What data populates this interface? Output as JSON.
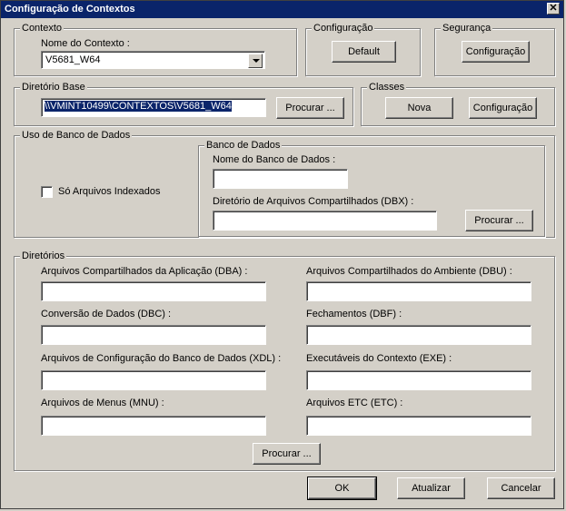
{
  "window": {
    "title": "Configuração de Contextos"
  },
  "contexto": {
    "legend": "Contexto",
    "nome_label": "Nome do Contexto :",
    "nome_value": "V5681_W64"
  },
  "configuracao": {
    "legend": "Configuração",
    "default_button": "Default"
  },
  "seguranca": {
    "legend": "Segurança",
    "config_button": "Configuração"
  },
  "diretorio_base": {
    "legend": "Diretório Base",
    "value": "\\\\VMINT10499\\CONTEXTOS\\V5681_W64",
    "procurar_button": "Procurar ..."
  },
  "classes": {
    "legend": "Classes",
    "nova_button": "Nova",
    "config_button": "Configuração"
  },
  "uso_banco": {
    "legend": "Uso de Banco de Dados",
    "so_indexados_label": "Só Arquivos Indexados",
    "banco_legend": "Banco de Dados",
    "nome_banco_label": "Nome do Banco de Dados :",
    "dbx_label": "Diretório de Arquivos Compartilhados (DBX) :",
    "procurar_button": "Procurar ..."
  },
  "diretorios": {
    "legend": "Diretórios",
    "dba_label": "Arquivos Compartilhados da Aplicação (DBA) :",
    "dbu_label": "Arquivos Compartilhados do Ambiente (DBU) :",
    "dbc_label": "Conversão de Dados (DBC) :",
    "dbf_label": "Fechamentos (DBF) :",
    "xdl_label": "Arquivos de Configuração do Banco de Dados (XDL) :",
    "exe_label": "Executáveis do Contexto (EXE) :",
    "mnu_label": "Arquivos de Menus (MNU) :",
    "etc_label": "Arquivos ETC (ETC) :",
    "procurar_button": "Procurar ..."
  },
  "footer": {
    "ok": "OK",
    "atualizar": "Atualizar",
    "cancelar": "Cancelar"
  }
}
